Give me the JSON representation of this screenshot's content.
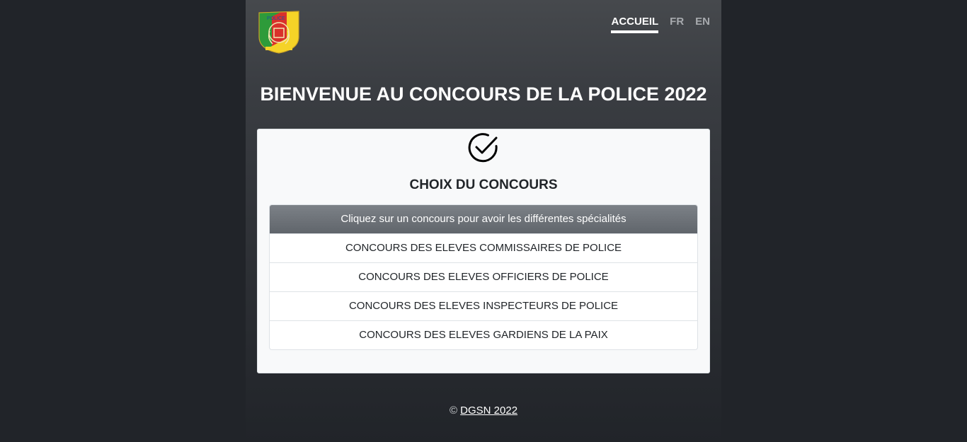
{
  "header": {
    "nav": [
      {
        "label": "ACCUEIL",
        "active": true
      },
      {
        "label": "FR",
        "active": false
      },
      {
        "label": "EN",
        "active": false
      }
    ]
  },
  "logo": {
    "text": "POLICE"
  },
  "headline": "BIENVENUE AU CONCOURS DE LA POLICE 2022",
  "card": {
    "icon": "check-circle-icon",
    "title": "CHOIX DU CONCOURS",
    "list_header": "Cliquez sur un concours pour avoir les différentes spécialités",
    "items": [
      "CONCOURS DES ELEVES COMMISSAIRES DE POLICE",
      "CONCOURS DES ELEVES OFFICIERS DE POLICE",
      "CONCOURS DES ELEVES INSPECTEURS DE POLICE",
      "CONCOURS DES ELEVES GARDIENS DE LA PAIX"
    ]
  },
  "footer": {
    "copyright_symbol": "©",
    "link": "DGSN 2022"
  },
  "colors": {
    "background": "#212429",
    "panel_top": "#46494d",
    "card_bg": "#f8f9fa",
    "list_header": "#6c757d",
    "logo_green": "#2e9b3a",
    "logo_red": "#d9312b",
    "logo_yellow": "#f5d327"
  }
}
